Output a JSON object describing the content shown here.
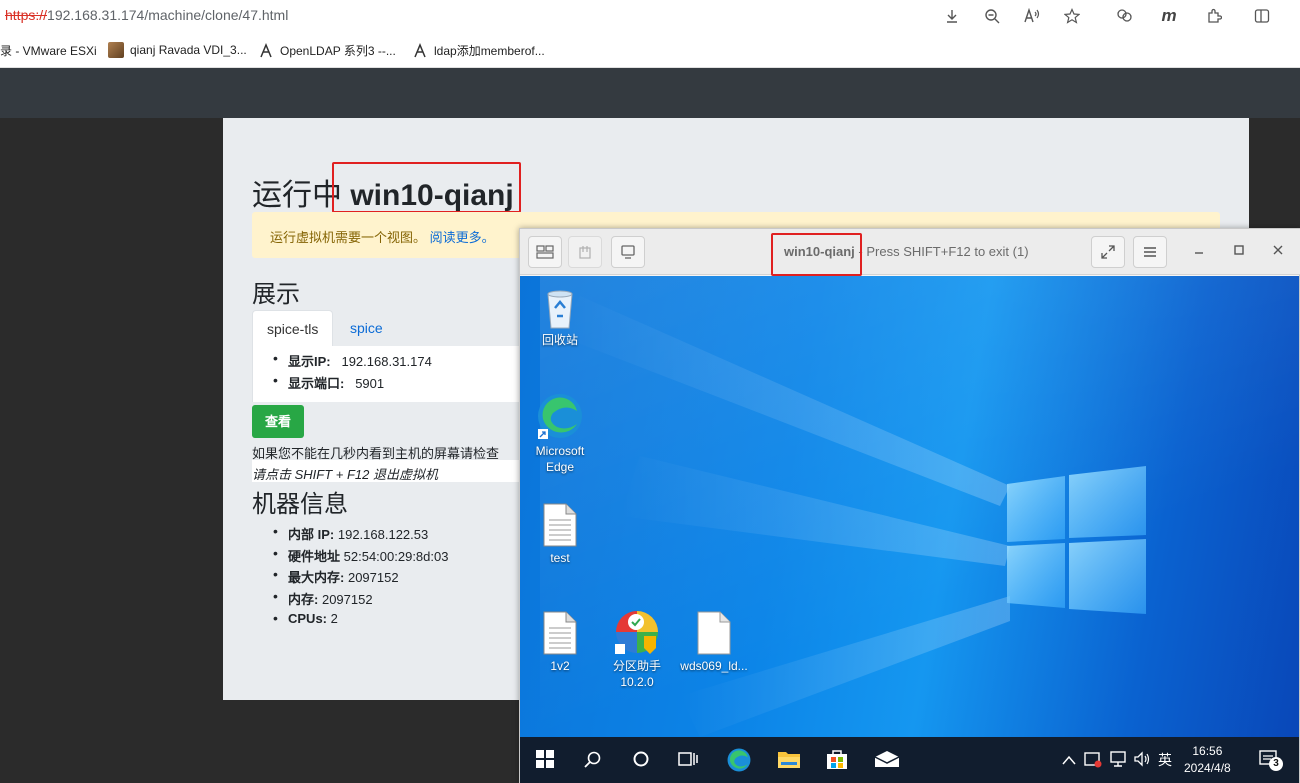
{
  "browser": {
    "url_scheme": "https://",
    "url_rest": "192.168.31.174/machine/clone/47.html",
    "bookmarks": [
      {
        "label": "录 - VMware ESXi"
      },
      {
        "label": "qianj Ravada VDI_3..."
      },
      {
        "label": "OpenLDAP 系列3 --..."
      },
      {
        "label": "ldap添加memberof..."
      }
    ],
    "toolbar_icons": [
      "download-icon",
      "zoom-icon",
      "read-aloud-icon",
      "favorite-star-icon",
      "collections-icon",
      "m-extension-icon",
      "extensions-icon",
      "split-screen-icon"
    ],
    "m_label": "m"
  },
  "page": {
    "title_prefix": "运行中",
    "title_name": "win10-qianj",
    "alert_text": "运行虚拟机需要一个视图。",
    "alert_link": "阅读更多。",
    "display_heading": "展示",
    "tabs": [
      "spice-tls",
      "spice"
    ],
    "display_info": [
      {
        "label": "显示IP:",
        "value": "192.168.31.174"
      },
      {
        "label": "显示端口:",
        "value": "5901"
      }
    ],
    "view_button": "查看",
    "help_text": "如果您不能在几秒内看到主机的屏幕请检查",
    "help_italic": "请点击 SHIFT + F12 退出虚拟机",
    "machine_heading": "机器信息",
    "machine_info": [
      {
        "label": "内部 IP:",
        "value": "192.168.122.53"
      },
      {
        "label": "硬件地址",
        "value": "52:54:00:29:8d:03"
      },
      {
        "label": "最大内存:",
        "value": "2097152"
      },
      {
        "label": "内存:",
        "value": "2097152"
      },
      {
        "label": "CPUs:",
        "value": "2"
      }
    ]
  },
  "viewer": {
    "title_name": "win10-qianj",
    "title_rest": " - Press SHIFT+F12 to exit (1)",
    "desktop_icons": [
      {
        "label": "回收站"
      },
      {
        "label": "Microsoft Edge"
      },
      {
        "label": "test"
      },
      {
        "label": "1v2"
      },
      {
        "label": "分区助手 10.2.0"
      },
      {
        "label": "wds069_ld..."
      }
    ],
    "tray_lang": "英",
    "clock_time": "16:56",
    "clock_date": "2024/4/8",
    "notif_count": "3"
  },
  "colors": {
    "highlight": "#e02020",
    "view_button": "#28a745",
    "link": "#0b6bd6"
  }
}
